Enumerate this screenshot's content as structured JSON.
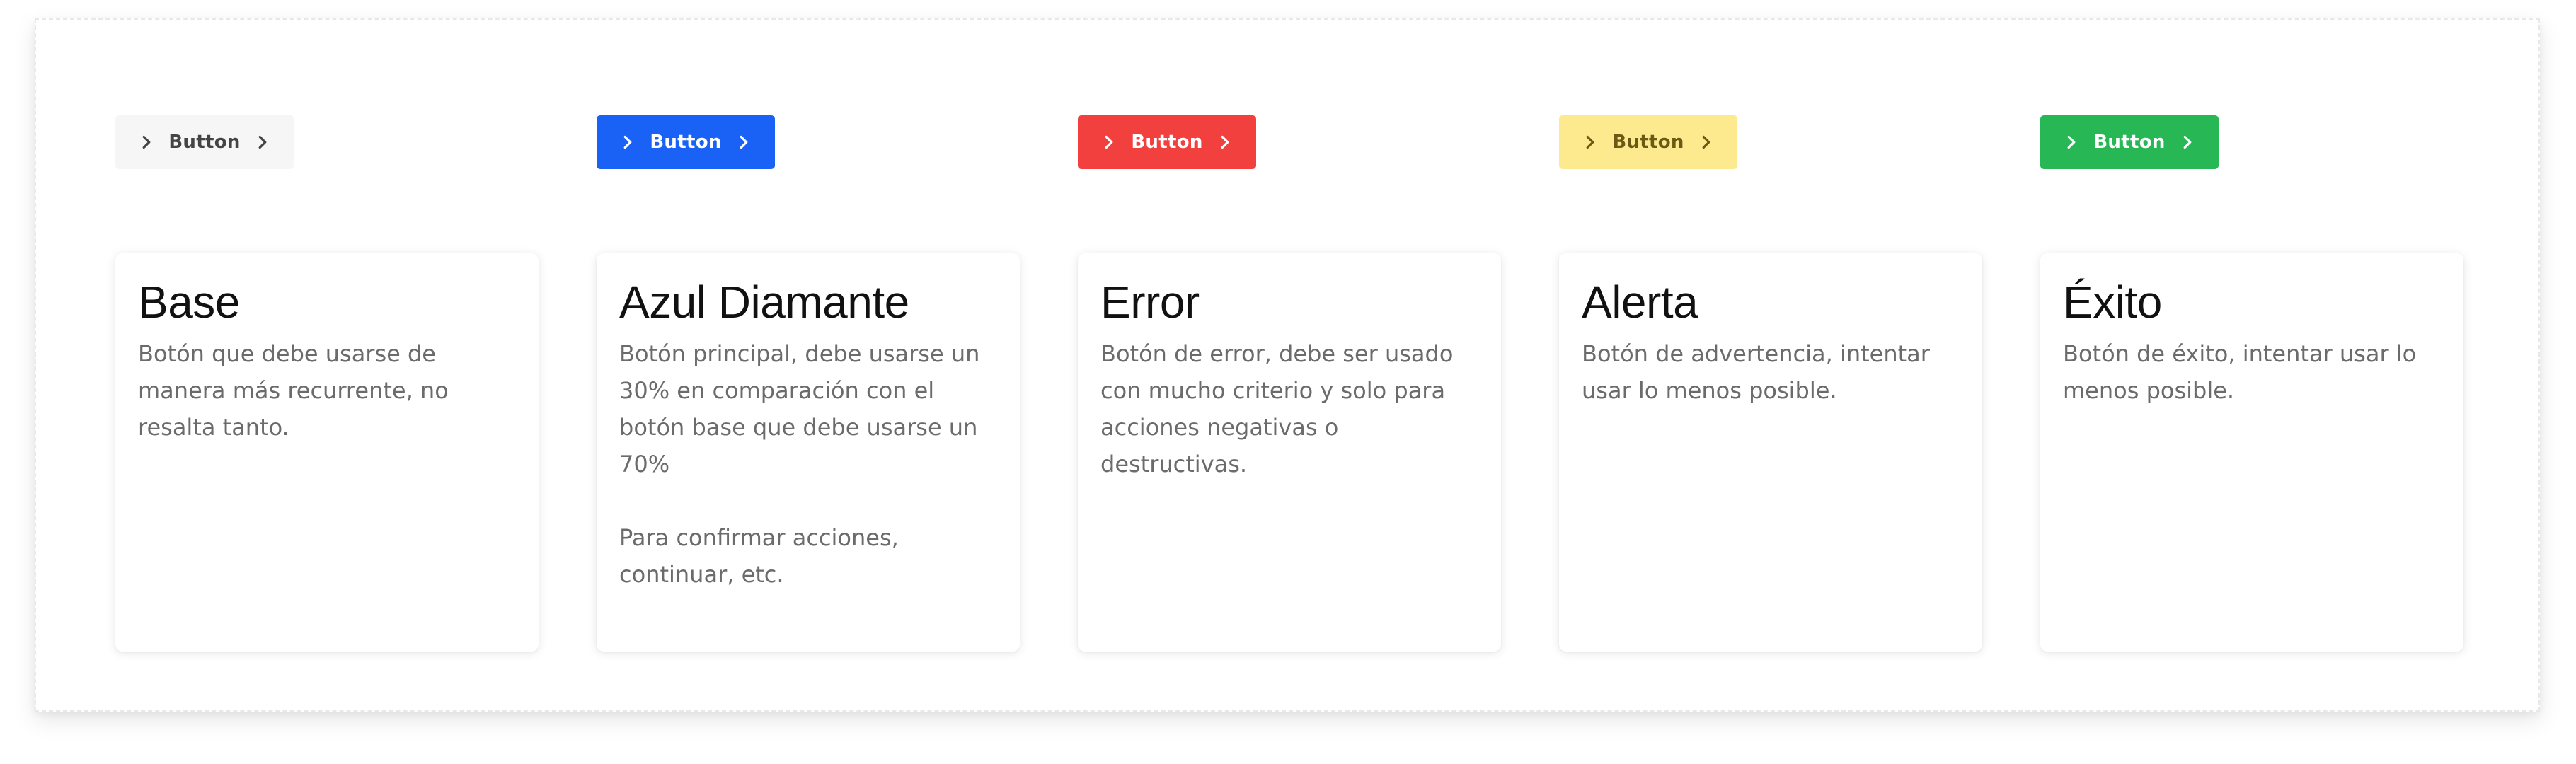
{
  "colors": {
    "base_bg": "#f6f6f6",
    "base_text": "#444444",
    "blue": "#1a61f5",
    "red": "#f2403f",
    "yellow": "#fde98e",
    "yellow_text": "#6b5a14",
    "green": "#27b855"
  },
  "buttons": [
    {
      "label": "Button",
      "variant": "base",
      "icons": [
        "chevron-right-icon",
        "chevron-right-icon"
      ]
    },
    {
      "label": "Button",
      "variant": "blue",
      "icons": [
        "chevron-right-icon",
        "chevron-right-icon"
      ]
    },
    {
      "label": "Button",
      "variant": "error",
      "icons": [
        "chevron-right-icon",
        "chevron-right-icon"
      ]
    },
    {
      "label": "Button",
      "variant": "warning",
      "icons": [
        "chevron-right-icon",
        "chevron-right-icon"
      ]
    },
    {
      "label": "Button",
      "variant": "success",
      "icons": [
        "chevron-right-icon",
        "chevron-right-icon"
      ]
    }
  ],
  "cards": [
    {
      "title": "Base",
      "description": "Botón que debe usarse de\nmanera más recurrente, no\nresalta tanto."
    },
    {
      "title": "Azul Diamante",
      "description": "Botón principal, debe usarse un\n30% en comparación con el\nbotón base que debe usarse un\n70%\n\nPara confirmar acciones,\ncontinuar, etc."
    },
    {
      "title": "Error",
      "description": "Botón de error, debe ser usado\ncon mucho criterio y solo para\nacciones negativas o\ndestructivas."
    },
    {
      "title": "Alerta",
      "description": "Botón de advertencia, intentar\nusar lo menos posible."
    },
    {
      "title": "Éxito",
      "description": "Botón de éxito, intentar usar lo\nmenos posible."
    }
  ]
}
